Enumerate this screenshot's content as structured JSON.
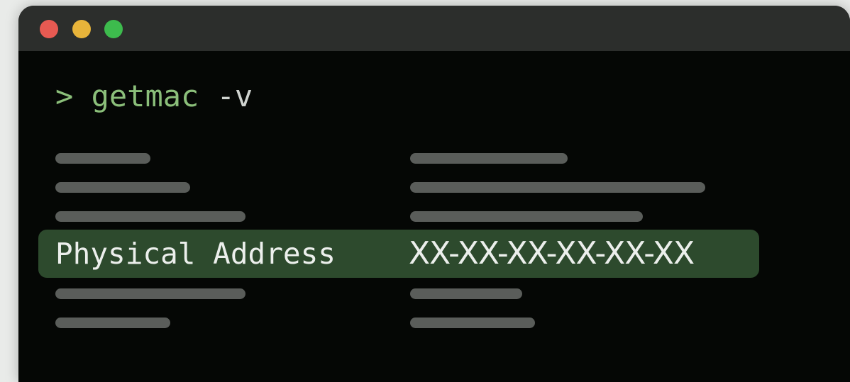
{
  "window": {
    "buttons": {
      "close": "close",
      "minimize": "minimize",
      "zoom": "zoom"
    }
  },
  "terminal": {
    "prompt": ">",
    "command": "getmac",
    "argument": "-v",
    "highlight": {
      "label": "Physical Address",
      "value": "XX-XX-XX-XX-XX-XX"
    }
  },
  "colors": {
    "terminal_bg": "#050705",
    "titlebar_bg": "#2c2e2c",
    "command_text": "#8bbf7a",
    "highlight_bg": "#2d4a2d",
    "placeholder_bar": "#5a5d5a",
    "close_button": "#e85a52",
    "minimize_button": "#e8b43a",
    "zoom_button": "#3dbb4d"
  }
}
